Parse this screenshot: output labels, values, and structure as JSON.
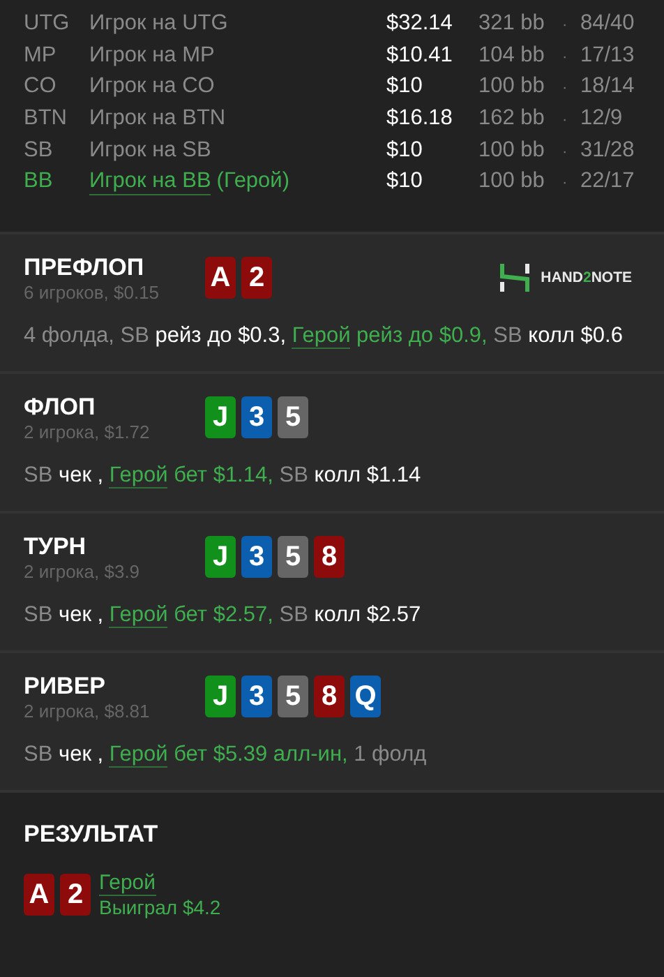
{
  "players": [
    {
      "position": "UTG",
      "name": "Игрок на UTG",
      "hero": false,
      "stack": "$32.14",
      "bb": "321 bb",
      "sep": "·",
      "hands": "84/40"
    },
    {
      "position": "MP",
      "name": "Игрок на MP",
      "hero": false,
      "stack": "$10.41",
      "bb": "104 bb",
      "sep": "·",
      "hands": "17/13"
    },
    {
      "position": "CO",
      "name": "Игрок на CO",
      "hero": false,
      "stack": "$10",
      "bb": "100 bb",
      "sep": "·",
      "hands": "18/14"
    },
    {
      "position": "BTN",
      "name": "Игрок на BTN",
      "hero": false,
      "stack": "$16.18",
      "bb": "162 bb",
      "sep": "·",
      "hands": "12/9"
    },
    {
      "position": "SB",
      "name": "Игрок на SB",
      "hero": false,
      "stack": "$10",
      "bb": "100 bb",
      "sep": "·",
      "hands": "31/28"
    },
    {
      "position": "BB",
      "name": "Игрок на BB",
      "hero": true,
      "hero_tag": "(Герой)",
      "stack": "$10",
      "bb": "100 bb",
      "sep": "·",
      "hands": "22/17"
    }
  ],
  "logo": {
    "before": "HAND",
    "accent": "2",
    "after": "NOTE"
  },
  "streets": [
    {
      "title": "ПРЕФЛОП",
      "info": "6 игроков, $0.15",
      "logo": true,
      "cards": [
        {
          "rank": "A",
          "color": "#8e0b0b"
        },
        {
          "rank": "2",
          "color": "#8e0b0b"
        }
      ],
      "actions": [
        {
          "kind": "muted",
          "text": "4 фолда, SB"
        },
        {
          "kind": "action",
          "text": "рейз до $0.3,"
        },
        {
          "kind": "hero",
          "name": "Герой",
          "text": "рейз до $0.9,"
        },
        {
          "kind": "muted",
          "text": "SB"
        },
        {
          "kind": "action",
          "text": "колл $0.6"
        }
      ]
    },
    {
      "title": "ФЛОП",
      "info": "2 игрока, $1.72",
      "logo": false,
      "cards": [
        {
          "rank": "J",
          "color": "#11901c"
        },
        {
          "rank": "3",
          "color": "#0c5fae"
        },
        {
          "rank": "5",
          "color": "#666666"
        }
      ],
      "actions": [
        {
          "kind": "muted",
          "text": "SB"
        },
        {
          "kind": "action",
          "text": "чек ,"
        },
        {
          "kind": "hero",
          "name": "Герой",
          "text": "бет $1.14,"
        },
        {
          "kind": "muted",
          "text": "SB"
        },
        {
          "kind": "action",
          "text": "колл $1.14"
        }
      ]
    },
    {
      "title": "ТУРН",
      "info": "2 игрока, $3.9",
      "logo": false,
      "cards": [
        {
          "rank": "J",
          "color": "#11901c"
        },
        {
          "rank": "3",
          "color": "#0c5fae"
        },
        {
          "rank": "5",
          "color": "#666666"
        },
        {
          "rank": "8",
          "color": "#8e0b0b"
        }
      ],
      "actions": [
        {
          "kind": "muted",
          "text": "SB"
        },
        {
          "kind": "action",
          "text": "чек ,"
        },
        {
          "kind": "hero",
          "name": "Герой",
          "text": "бет $2.57,"
        },
        {
          "kind": "muted",
          "text": "SB"
        },
        {
          "kind": "action",
          "text": "колл $2.57"
        }
      ]
    },
    {
      "title": "РИВЕР",
      "info": "2 игрока, $8.81",
      "logo": false,
      "cards": [
        {
          "rank": "J",
          "color": "#11901c"
        },
        {
          "rank": "3",
          "color": "#0c5fae"
        },
        {
          "rank": "5",
          "color": "#666666"
        },
        {
          "rank": "8",
          "color": "#8e0b0b"
        },
        {
          "rank": "Q",
          "color": "#0c5fae"
        }
      ],
      "actions": [
        {
          "kind": "muted",
          "text": "SB"
        },
        {
          "kind": "action",
          "text": "чек ,"
        },
        {
          "kind": "hero",
          "name": "Герой",
          "text": "бет $5.39 алл-ин,"
        },
        {
          "kind": "muted",
          "text": "1 фолд"
        }
      ]
    }
  ],
  "result": {
    "title": "РЕЗУЛЬТАТ",
    "cards": [
      {
        "rank": "A",
        "color": "#8e0b0b"
      },
      {
        "rank": "2",
        "color": "#8e0b0b"
      }
    ],
    "name": "Герой",
    "outcome": "Выиграл $4.2"
  }
}
